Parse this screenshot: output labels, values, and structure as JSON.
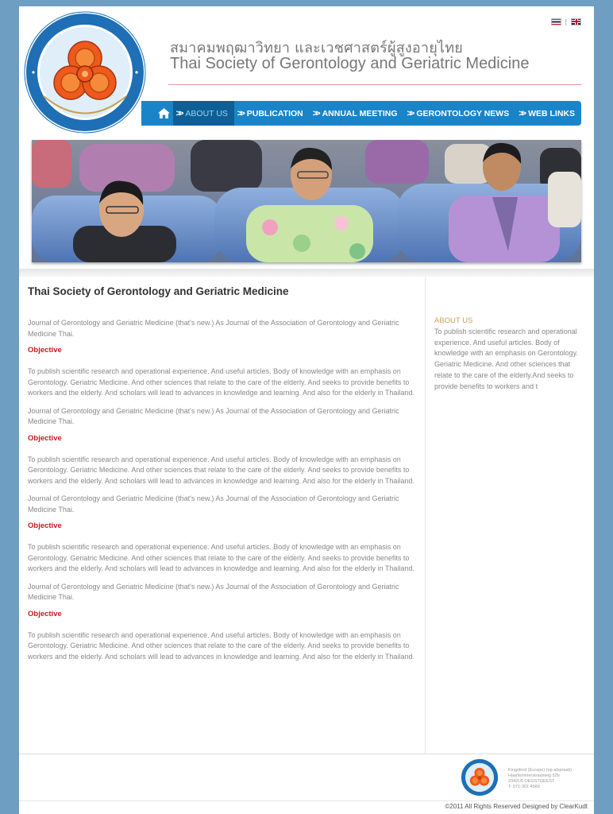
{
  "header": {
    "logo_alt_text": "สมาคมพฤฒาวิทยาและเวชศาสตร์ผู้สูงอายุไทย THAI SOCIETY OF GERONTOLOGY AND GERIATRIC MEDICINE",
    "title_th": "สมาคมพฤฒาวิทยา และเวชศาสตร์ผู้สูงอายุไทย",
    "title_en": "Thai Society of Gerontology and Geriatric Medicine",
    "lang_separator": "|",
    "languages": [
      "thai-flag-icon",
      "uk-flag-icon"
    ]
  },
  "nav": {
    "home_icon": "home-icon",
    "items": [
      {
        "label": "ABOUT US",
        "active": true
      },
      {
        "label": "PUBLICATION",
        "active": false
      },
      {
        "label": "ANNUAL MEETING",
        "active": false
      },
      {
        "label": "GERONTOLOGY NEWS",
        "active": false
      },
      {
        "label": "WEB LINKS",
        "active": false
      }
    ]
  },
  "main": {
    "heading": "Thai Society of Gerontology and Geriatric Medicine",
    "intro": "Journal of Gerontology and Geriatric Medicine (that's new.) As Journal of the Association of Gerontology and Geriatric Medicine Thai.",
    "sections": [
      {
        "title": "Objective",
        "body": "To publish scientific research and operational experience. And useful articles. Body of knowledge with an emphasis on Gerontology. Geriatric Medicine. And other sciences that relate to the care of the elderly. And seeks to provide benefits to workers and the elderly. And scholars will lead to advances in knowledge and learning. And also for the elderly in Thailand.",
        "after": "Journal of Gerontology and Geriatric Medicine (that's new.) As Journal of the Association of Gerontology and Geriatric Medicine Thai."
      },
      {
        "title": "Objective",
        "body": "To publish scientific research and operational experience. And useful articles. Body of knowledge with an emphasis on Gerontology. Geriatric Medicine. And other sciences that relate to the care of the elderly. And seeks to provide benefits to workers and the elderly. And scholars will lead to advances in knowledge and learning. And also for the elderly in Thailand.",
        "after": "Journal of Gerontology and Geriatric Medicine (that's new.) As Journal of the Association of Gerontology and Geriatric Medicine Thai."
      },
      {
        "title": "Objective",
        "body": "To publish scientific research and operational experience. And useful articles. Body of knowledge with an emphasis on Gerontology. Geriatric Medicine. And other sciences that relate to the care of the elderly. And seeks to provide benefits to workers and the elderly. And scholars will lead to advances in knowledge and learning. And also for the elderly in Thailand.",
        "after": "Journal of Gerontology and Geriatric Medicine (that's new.) As Journal of the Association of Gerontology and Geriatric Medicine Thai."
      },
      {
        "title": "Objective",
        "body": "To publish scientific research and operational experience. And useful articles. Body of knowledge with an emphasis on Gerontology. Geriatric Medicine. And other sciences that relate to the care of the elderly. And seeks to provide benefits to workers and the elderly. And scholars will lead to advances in knowledge and learning. And also for the elderly in Thailand.",
        "after": ""
      }
    ]
  },
  "sidebar": {
    "title": "ABOUT US",
    "text": "To publish scientific research and operational experience. And useful articles. Body of knowledge with an emphasis on Gerontology. Geriatric Medicine. And other sciences that relate to the care of the elderly.And seeks to provide benefits to workers and t"
  },
  "footer": {
    "address": [
      "Kingsford (Europe) (op afspraak)",
      "Haarlemmerstraatweg 52b",
      "2342LB OEGSTGEEST",
      "T: 071-301 4589"
    ],
    "copyright": "©2011 All Rights Reserved Designed by ClearKudt"
  },
  "colors": {
    "background": "#6e9ec2",
    "nav": "#1a84c9",
    "nav_active": "#0d5f97",
    "accent_red": "#c61a1a",
    "sidebar_title": "#c99e5a",
    "logo_ring": "#1e6fb5",
    "logo_orange": "#ee5a1c"
  }
}
